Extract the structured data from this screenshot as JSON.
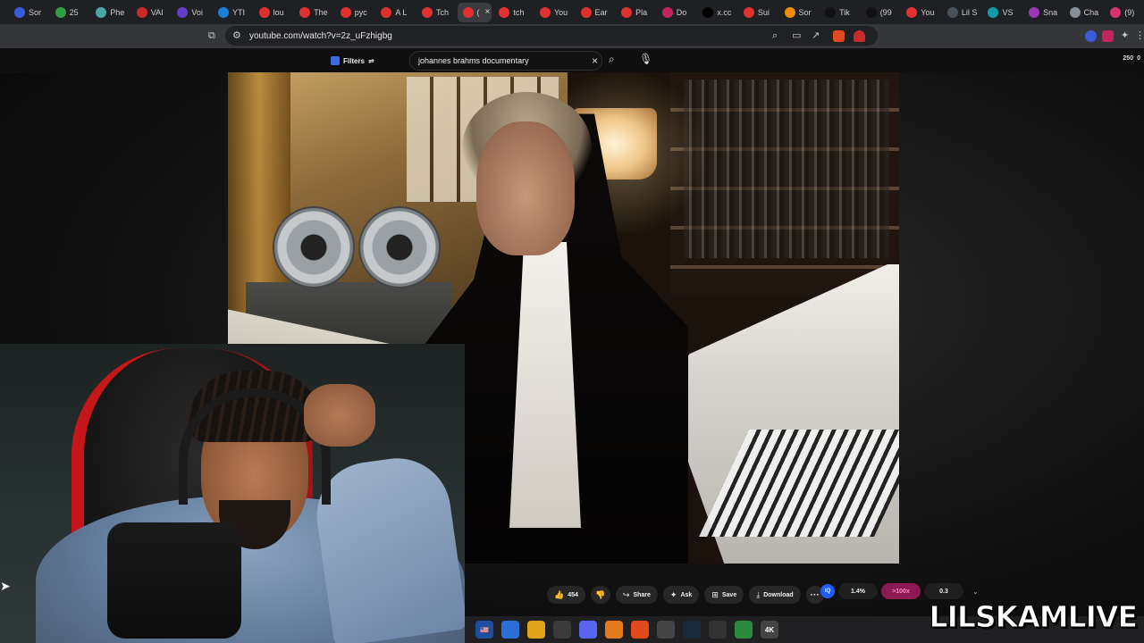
{
  "browser": {
    "tabs": [
      {
        "label": "Sor",
        "color": "#3b5bdb"
      },
      {
        "label": "25",
        "color": "#2f9e44"
      },
      {
        "label": "Phe",
        "color": "#4ea5a5"
      },
      {
        "label": "VAI",
        "color": "#c92a2a"
      },
      {
        "label": "Voi",
        "color": "#5f3dc4"
      },
      {
        "label": "YTI",
        "color": "#1c7ed6"
      },
      {
        "label": "lou",
        "color": "#e03131"
      },
      {
        "label": "The",
        "color": "#e03131"
      },
      {
        "label": "pyc",
        "color": "#e03131"
      },
      {
        "label": "A L",
        "color": "#e03131"
      },
      {
        "label": "Tch",
        "color": "#e03131"
      },
      {
        "label": "(",
        "color": "#e03131",
        "active": true
      },
      {
        "label": "tch",
        "color": "#e03131"
      },
      {
        "label": "You",
        "color": "#e03131"
      },
      {
        "label": "Ear",
        "color": "#e03131"
      },
      {
        "label": "Pla",
        "color": "#e03131"
      },
      {
        "label": "Do",
        "color": "#c2255c"
      },
      {
        "label": "x.cc",
        "color": "#000000"
      },
      {
        "label": "Sui",
        "color": "#e03131"
      },
      {
        "label": "Sor",
        "color": "#f08c00"
      },
      {
        "label": "Tik",
        "color": "#111111"
      },
      {
        "label": "(99",
        "color": "#111111"
      },
      {
        "label": "You",
        "color": "#e03131"
      },
      {
        "label": "Lil S",
        "color": "#495057"
      },
      {
        "label": "VS",
        "color": "#1098ad"
      },
      {
        "label": "Sna",
        "color": "#9c36b5"
      },
      {
        "label": "Cha",
        "color": "#868e96"
      },
      {
        "label": "(9)",
        "color": "#d6336c"
      }
    ],
    "active_tab_close": "×",
    "url": "youtube.com/watch?v=2z_uFzhigbg",
    "bookmark_icon": "bookmark-icon",
    "site_info_icon": "tune-icon"
  },
  "youtube": {
    "filters_label": "Filters",
    "search_value": "johannes brahms documentary",
    "clear_glyph": "×",
    "counter_left": "250",
    "counter_right": "0"
  },
  "actions": {
    "like_count": "454",
    "share_label": "Share",
    "ask_label": "Ask",
    "save_label": "Save",
    "download_label": "Download",
    "more_glyph": "···"
  },
  "stats": {
    "logo_text": "IQ",
    "stat1": "1.4%",
    "stat2": ">100x",
    "stat3": "0.3"
  },
  "taskbar": {
    "icons": [
      {
        "name": "flag-icon",
        "color": "#1c4fa0",
        "text": "🇺🇸"
      },
      {
        "name": "copilot-icon",
        "color": "#2b6fd6",
        "text": ""
      },
      {
        "name": "file-explorer-icon",
        "color": "#e0a21a",
        "text": ""
      },
      {
        "name": "store-icon",
        "color": "#3a3a3a",
        "text": ""
      },
      {
        "name": "discord-icon",
        "color": "#5865f2",
        "text": ""
      },
      {
        "name": "fl-studio-icon",
        "color": "#e37b1c",
        "text": ""
      },
      {
        "name": "brave-icon",
        "color": "#e2491c",
        "text": ""
      },
      {
        "name": "chatgpt-icon",
        "color": "#444",
        "text": ""
      },
      {
        "name": "steam-icon",
        "color": "#1b2838",
        "text": ""
      },
      {
        "name": "app-icon",
        "color": "#333",
        "text": ""
      },
      {
        "name": "pc-icon",
        "color": "#2b8a3e",
        "text": ""
      },
      {
        "name": "4k-icon",
        "color": "#444",
        "text": "4K"
      }
    ]
  },
  "watermark": "LILSKAMLIVE"
}
